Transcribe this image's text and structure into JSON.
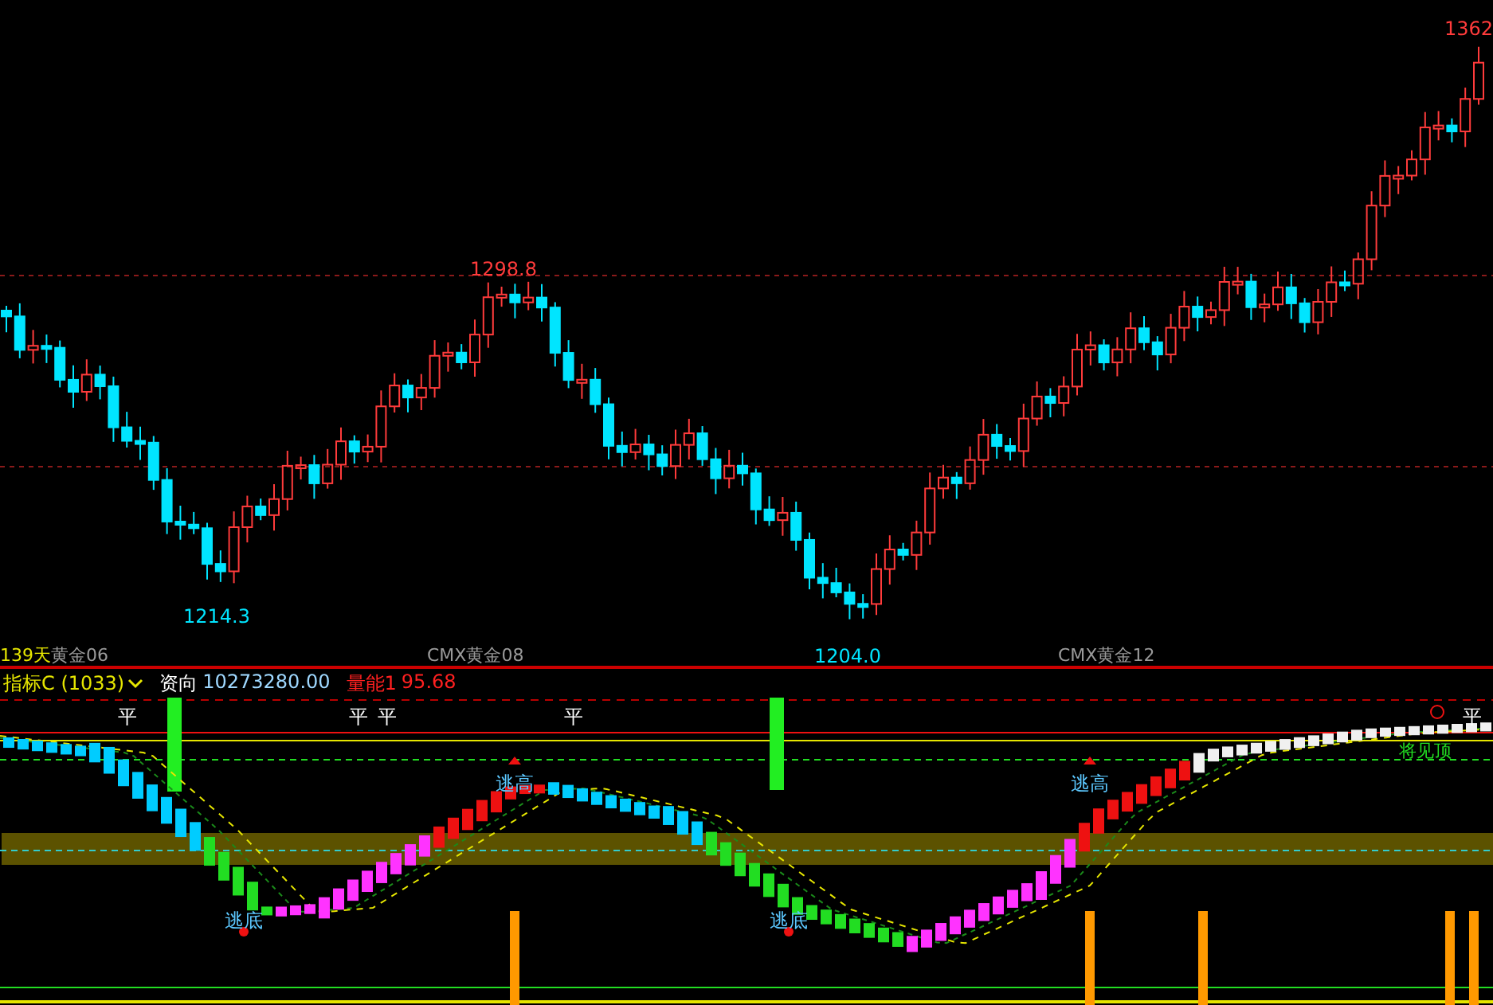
{
  "chart": {
    "price_labels": [
      "1362",
      "1298.8",
      "1214.3",
      "1204.0"
    ]
  },
  "time_axis": {
    "labels": [
      "139天",
      "黄金06",
      "CMX黄金08",
      "CMX黄金12"
    ]
  },
  "indicator": {
    "name": "指标C (1033)",
    "fields": [
      {
        "label": "资向",
        "value": "10273280.00",
        "kind": "normal"
      },
      {
        "label": "量能1",
        "value": "95.68",
        "kind": "alert"
      }
    ],
    "flat_marks": [
      "平",
      "平",
      "平",
      "平",
      "平"
    ],
    "warning": "将见顶",
    "signals": [
      {
        "text": "逃高",
        "kind": "top"
      },
      {
        "text": "逃高",
        "kind": "top"
      },
      {
        "text": "逃底",
        "kind": "bottom"
      },
      {
        "text": "逃底",
        "kind": "bottom"
      }
    ]
  }
}
